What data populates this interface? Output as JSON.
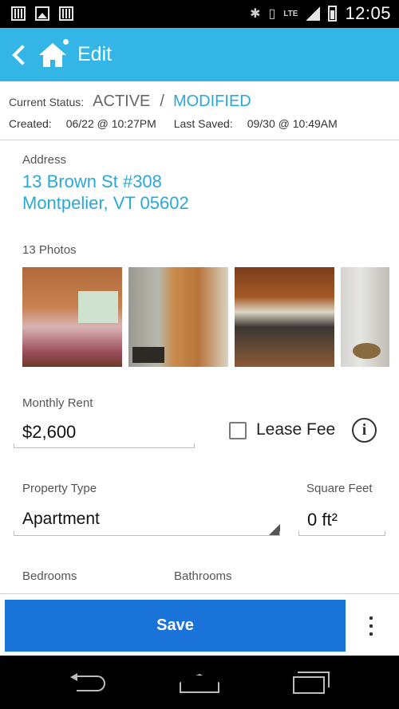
{
  "status_bar": {
    "time": "12:05",
    "network": "LTE",
    "icons": [
      "notification-bars-icon",
      "image-icon",
      "notification-bars-icon",
      "bluetooth-icon",
      "vibrate-icon",
      "signal-icon",
      "battery-icon"
    ]
  },
  "app_bar": {
    "title": "Edit",
    "color": "#33b5e5"
  },
  "status": {
    "current_label": "Current Status:",
    "current_value": "ACTIVE",
    "separator": "/",
    "modified_value": "MODIFIED",
    "created_label": "Created:",
    "created_value": "06/22 @ 10:27PM",
    "saved_label": "Last Saved:",
    "saved_value": "09/30 @ 10:49AM"
  },
  "address": {
    "label": "Address",
    "line1": "13 Brown St  #308",
    "line2": "Montpelier, VT 05602"
  },
  "photos": {
    "label": "13 Photos"
  },
  "rent": {
    "label": "Monthly Rent",
    "value": "$2,600"
  },
  "lease_fee": {
    "label": "Lease Fee",
    "checked": false
  },
  "property_type": {
    "label": "Property Type",
    "value": "Apartment"
  },
  "square_feet": {
    "label": "Square Feet",
    "value": "0 ft²"
  },
  "bedrooms": {
    "label": "Bedrooms"
  },
  "bathrooms": {
    "label": "Bathrooms"
  },
  "actions": {
    "save_label": "Save",
    "accent": "#1a73d9"
  }
}
